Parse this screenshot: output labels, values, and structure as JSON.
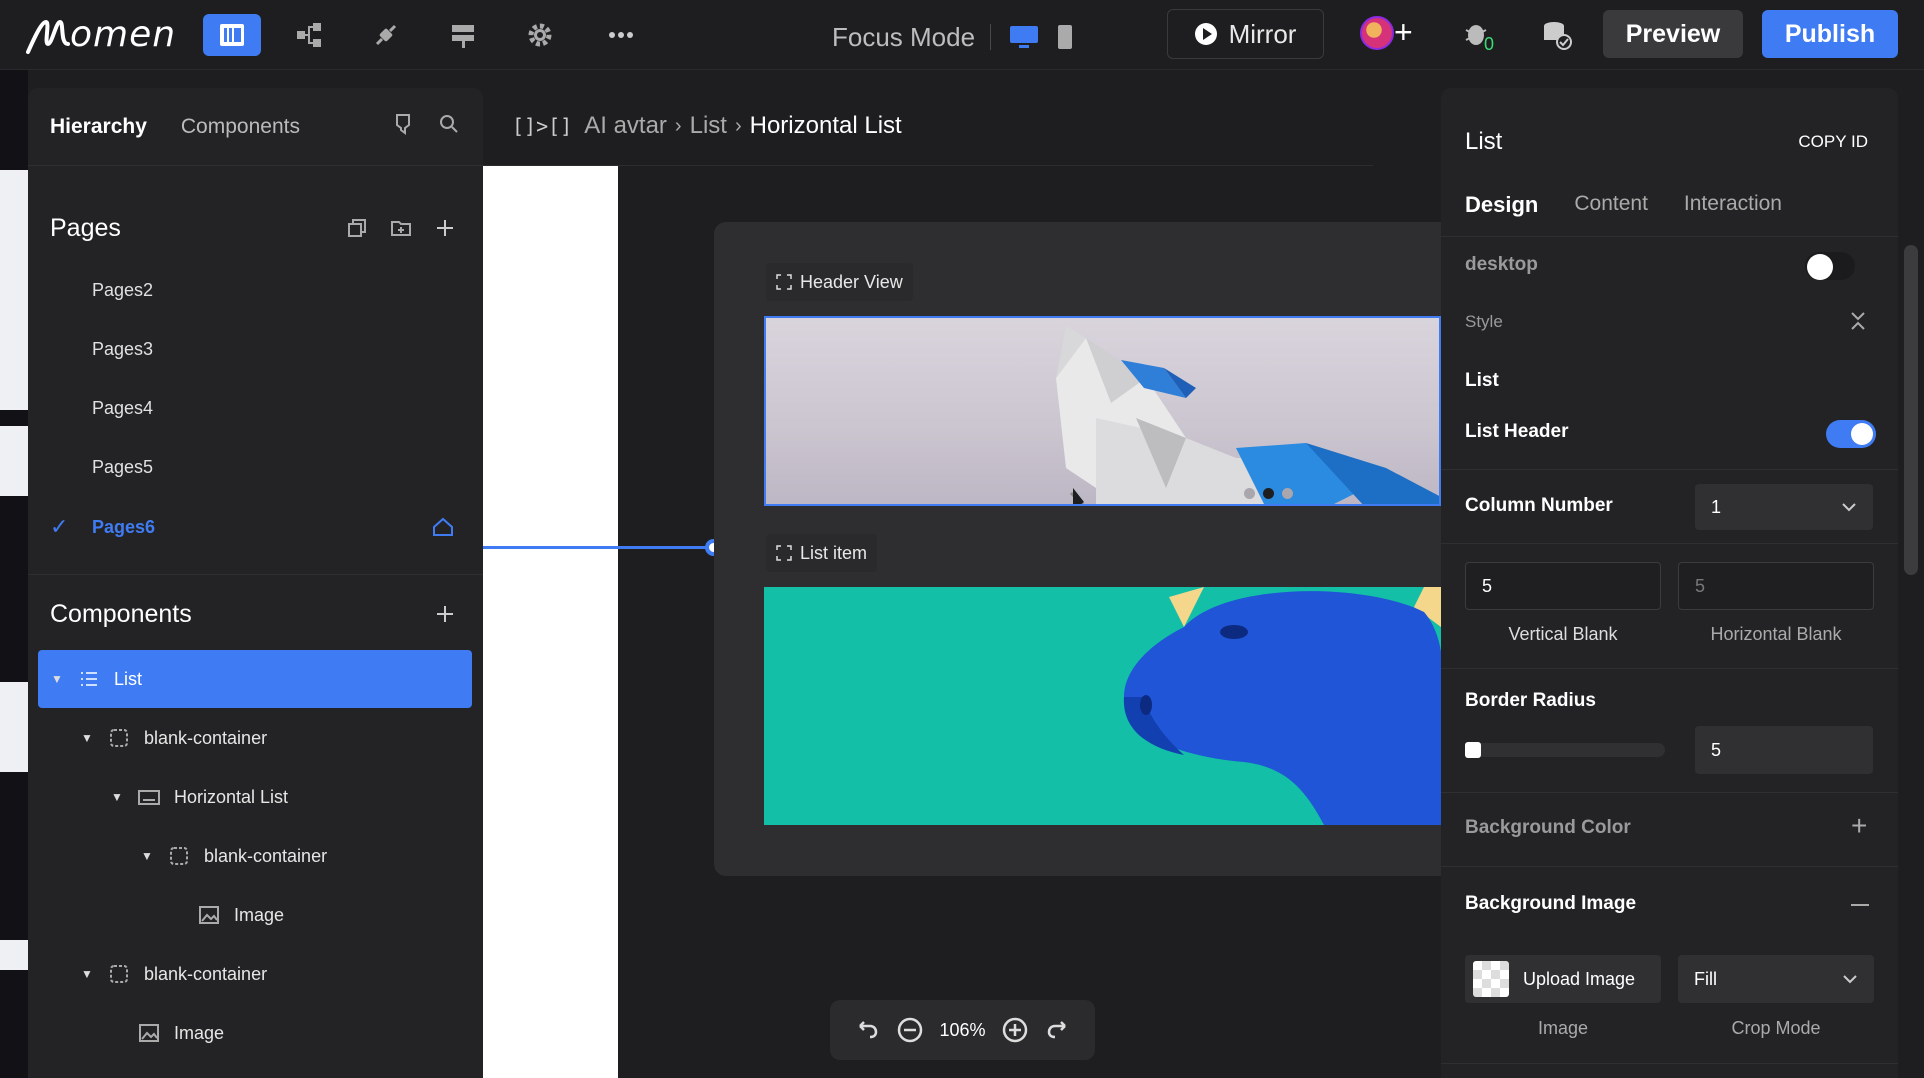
{
  "app": {
    "logo_text": "omen"
  },
  "toolbar": {
    "focus_mode_label": "Focus Mode",
    "mirror_label": "Mirror",
    "preview_label": "Preview",
    "publish_label": "Publish",
    "bug_badge": "0",
    "accent_color": "#3f7cf3"
  },
  "left_panel": {
    "tabs": [
      "Hierarchy",
      "Components"
    ],
    "pages_title": "Pages",
    "pages": [
      {
        "label": "Pages2",
        "active": false
      },
      {
        "label": "Pages3",
        "active": false
      },
      {
        "label": "Pages4",
        "active": false
      },
      {
        "label": "Pages5",
        "active": false
      },
      {
        "label": "Pages6",
        "active": true
      }
    ],
    "components_title": "Components",
    "tree": [
      {
        "label": "List",
        "icon": "list-icon",
        "selected": true
      },
      {
        "label": "blank-container",
        "icon": "container-icon"
      },
      {
        "label": "Horizontal List",
        "icon": "horizontal-list-icon"
      },
      {
        "label": "blank-container",
        "icon": "container-icon"
      },
      {
        "label": "Image",
        "icon": "image-icon"
      },
      {
        "label": "blank-container",
        "icon": "container-icon"
      },
      {
        "label": "Image",
        "icon": "image-icon"
      }
    ]
  },
  "canvas": {
    "breadcrumb": [
      "AI avtar",
      "List",
      "Horizontal List"
    ],
    "header_tag": "Header View",
    "item_tag": "List item",
    "zoom": "106%"
  },
  "right_panel": {
    "title": "List",
    "copy_id": "COPY ID",
    "tabs": [
      "Design",
      "Content",
      "Interaction"
    ],
    "desktop_label": "desktop",
    "style_label": "Style",
    "list_section": "List",
    "list_header_label": "List Header",
    "list_header_on": true,
    "column_number_label": "Column Number",
    "column_number_value": "1",
    "vertical_blank_value": "5",
    "horizontal_blank_value": "5",
    "vertical_blank_label": "Vertical Blank",
    "horizontal_blank_label": "Horizontal Blank",
    "border_radius_label": "Border Radius",
    "border_radius_value": "5",
    "background_color_label": "Background Color",
    "background_image_label": "Background Image",
    "upload_image_label": "Upload Image",
    "crop_mode_value": "Fill",
    "image_label": "Image",
    "crop_mode_label": "Crop Mode"
  }
}
